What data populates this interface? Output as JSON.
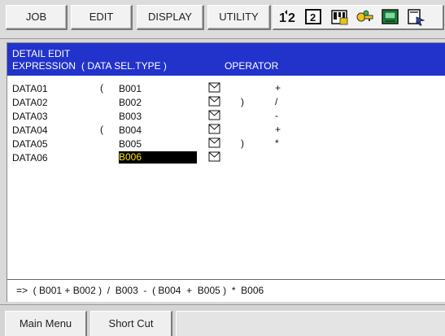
{
  "menu": {
    "job_label": "JOB",
    "edit_label": "EDIT",
    "display_label": "DISPLAY",
    "utility_label": "UTILITY"
  },
  "toolbar_icons": [
    "tool-switch-icon",
    "job-select-icon",
    "memory-card-icon",
    "security-key-icon",
    "display-screen-icon",
    "page-cursor-icon"
  ],
  "panel": {
    "title": "DETAIL EDIT",
    "col_expression": "EXPRESSION",
    "col_data_sel_type": "( DATA  SEL.TYPE )",
    "col_operator": "OPERATOR",
    "rows": [
      {
        "name": "DATA01",
        "lparen": "(",
        "data": "B001",
        "rparen": "",
        "op": "+"
      },
      {
        "name": "DATA02",
        "lparen": "",
        "data": "B002",
        "rparen": ")",
        "op": "/"
      },
      {
        "name": "DATA03",
        "lparen": "",
        "data": "B003",
        "rparen": "",
        "op": "-"
      },
      {
        "name": "DATA04",
        "lparen": "(",
        "data": "B004",
        "rparen": "",
        "op": "+"
      },
      {
        "name": "DATA05",
        "lparen": "",
        "data": "B005",
        "rparen": ")",
        "op": "*"
      },
      {
        "name": "DATA06",
        "lparen": "",
        "data": "B006",
        "rparen": "",
        "op": ""
      }
    ],
    "selected_row": 5,
    "expression": "=>  ( B001 + B002 )  /  B003  -  ( B004  +  B005 )  *  B006"
  },
  "bottom": {
    "main_menu_label": "Main Menu",
    "short_cut_label": "Short Cut"
  },
  "colors": {
    "header_blue": "#2233cc",
    "selection_bg": "#000000",
    "selection_text": "#ffe600"
  }
}
